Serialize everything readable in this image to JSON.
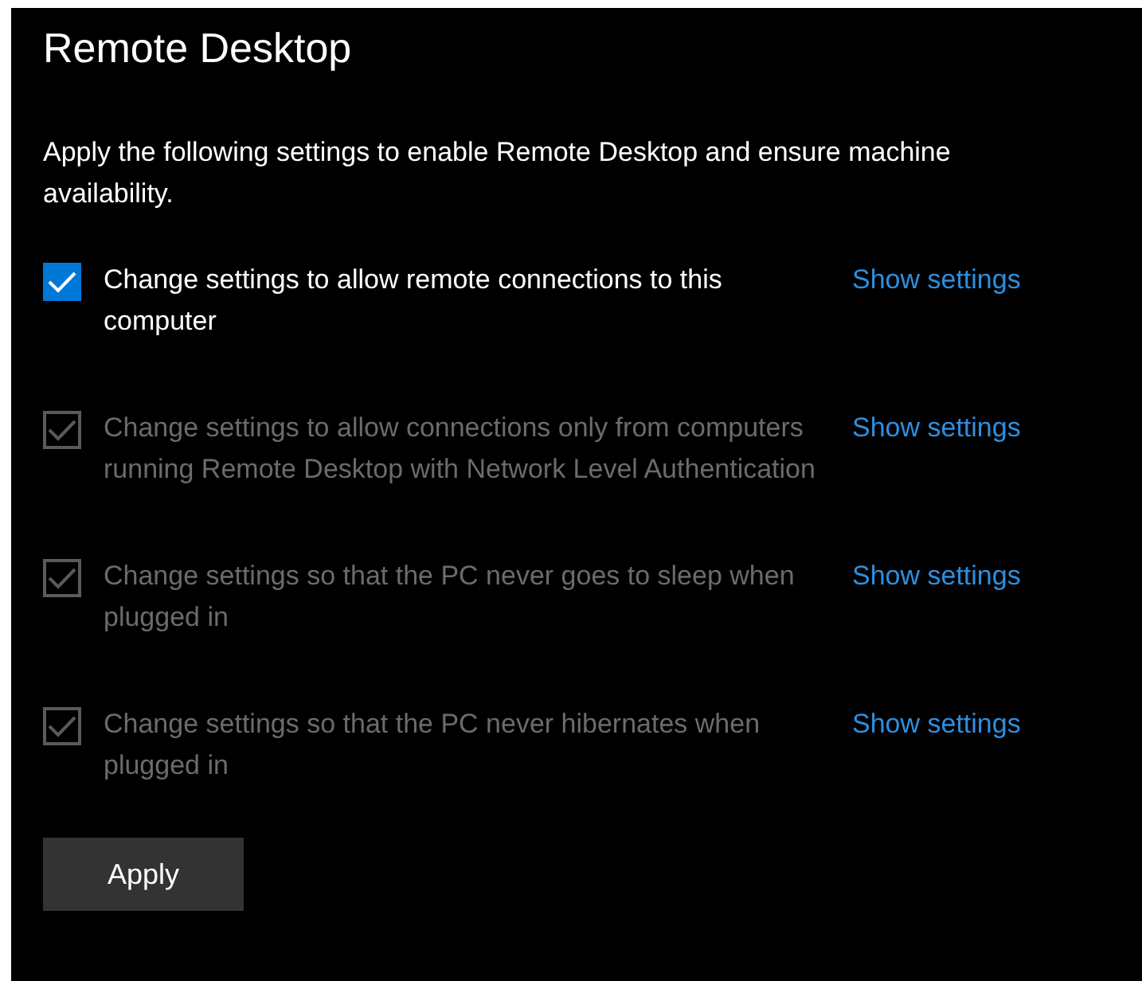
{
  "title": "Remote Desktop",
  "description": "Apply the following settings to enable Remote Desktop and ensure machine availability.",
  "settings": [
    {
      "label": "Change settings to allow remote connections to this computer",
      "checked": true,
      "disabled": false,
      "link": "Show settings"
    },
    {
      "label": "Change settings to allow connections only from computers running Remote Desktop with Network Level Authentication",
      "checked": true,
      "disabled": true,
      "link": "Show settings"
    },
    {
      "label": "Change settings so that the PC never goes to sleep when plugged in",
      "checked": true,
      "disabled": true,
      "link": "Show settings"
    },
    {
      "label": "Change settings so that the PC never hibernates when plugged in",
      "checked": true,
      "disabled": true,
      "link": "Show settings"
    }
  ],
  "apply_button": "Apply"
}
